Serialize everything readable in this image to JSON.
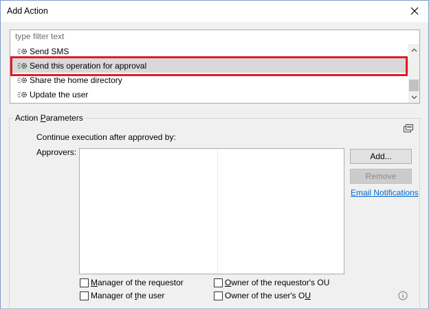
{
  "window": {
    "title": "Add Action"
  },
  "filter": {
    "placeholder": "type filter text"
  },
  "actions_list": {
    "items": [
      {
        "label": "Send SMS",
        "icon": "gear-icon",
        "selected": false
      },
      {
        "label": "Send this operation for approval",
        "icon": "gear-icon",
        "selected": true
      },
      {
        "label": "Share the home directory",
        "icon": "gear-icon",
        "selected": false
      },
      {
        "label": "Update the user",
        "icon": "gear-icon",
        "selected": false
      }
    ],
    "highlight_color": "#e01b24",
    "selected_bg": "#d9d9d9"
  },
  "params": {
    "group_title_pre": "Action ",
    "group_title_u": "P",
    "group_title_post": "arameters",
    "continue_label": "Continue execution after approved by:",
    "approvers_label": "Approvers:",
    "add_button": "Add...",
    "remove_button": "Remove",
    "email_link": "Email Notifications",
    "checkboxes": {
      "manager_requestor": {
        "pre": "",
        "u": "M",
        "post": "anager of the requestor"
      },
      "owner_requestor_ou": {
        "pre": "",
        "u": "O",
        "post": "wner of the requestor's OU"
      },
      "manager_user": {
        "pre": "Manager of ",
        "u": "t",
        "post": "he user"
      },
      "owner_user_ou": {
        "pre": "Owner of the user's O",
        "u": "U",
        "post": ""
      }
    }
  },
  "colors": {
    "link": "#0066cc",
    "accent_red": "#e01b24"
  }
}
